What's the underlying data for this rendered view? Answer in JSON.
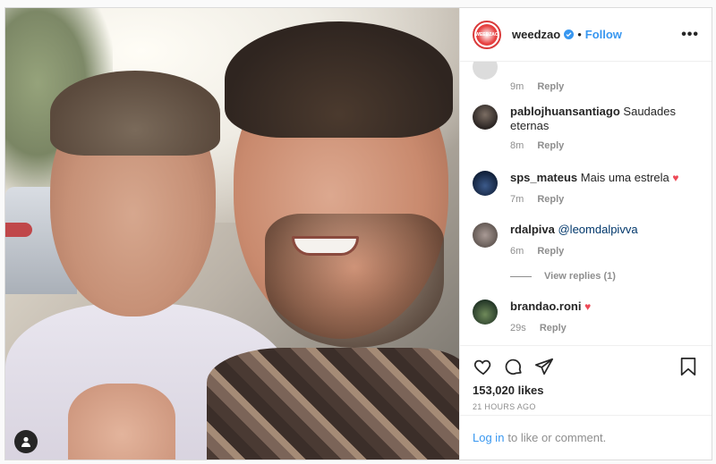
{
  "post": {
    "username": "weedzao",
    "avatar_text": "WEEDZAO",
    "follow_label": "Follow",
    "dot": "•",
    "more_label": "•••"
  },
  "comments": [
    {
      "user": "",
      "text": "",
      "time": "9m",
      "reply": "Reply"
    },
    {
      "user": "pablojhuansantiago",
      "text": "Saudades eternas",
      "time": "8m",
      "reply": "Reply"
    },
    {
      "user": "sps_mateus",
      "text": "Mais uma estrela",
      "emoji": "♥",
      "time": "7m",
      "reply": "Reply"
    },
    {
      "user": "rdalpiva",
      "mention": "@leomdalpivva",
      "time": "6m",
      "reply": "Reply",
      "view_replies": "View replies (1)"
    },
    {
      "user": "brandao.roni",
      "emoji": "♥",
      "time": "29s",
      "reply": "Reply"
    }
  ],
  "actions": {
    "likes": "153,020 likes",
    "time_ago": "21 HOURS AGO",
    "login_link": "Log in",
    "login_suffix": "to like or comment."
  },
  "icons": [
    "heart-icon",
    "comment-icon",
    "share-icon",
    "bookmark-icon",
    "user-tag-icon",
    "verified-icon"
  ],
  "colors": {
    "link": "#3897f0",
    "heart": "#ed4956",
    "muted": "#8e8e8e"
  }
}
